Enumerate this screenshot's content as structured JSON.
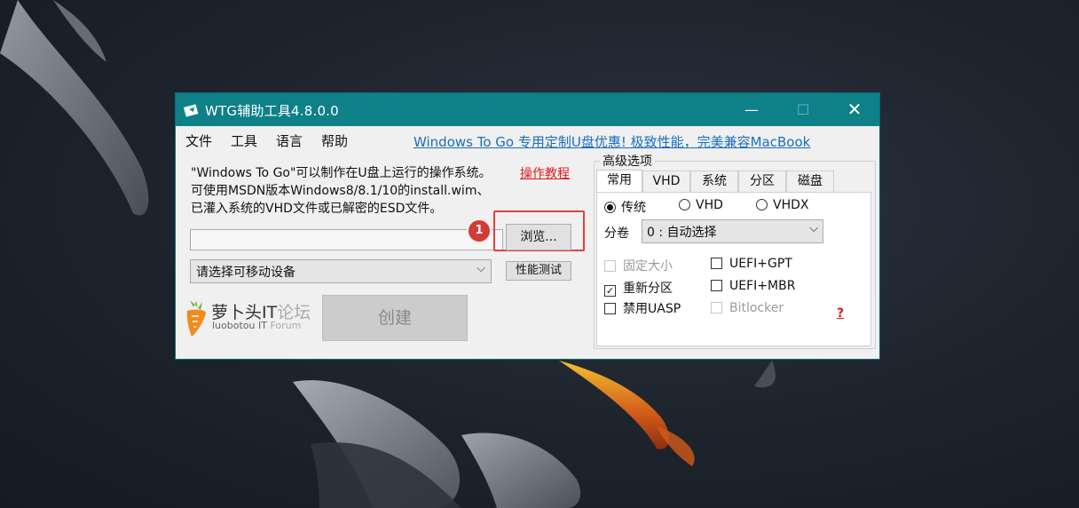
{
  "window": {
    "title": "WTG辅助工具4.8.0.0",
    "minimize_glyph": "—",
    "maximize_glyph": "☐",
    "close_glyph": "✕"
  },
  "menu": {
    "items": [
      "文件",
      "工具",
      "语言",
      "帮助"
    ],
    "promo_link": "Windows To Go 专用定制U盘优惠! 极致性能，完美兼容MacBook"
  },
  "description": {
    "lines": [
      "\"Windows To Go\"可以制作在U盘上运行的操作系统。",
      "可使用MSDN版本Windows8/8.1/10的install.wim、",
      "已灌入系统的VHD文件或已解密的ESD文件。"
    ],
    "tutorial_link": "操作教程"
  },
  "image_path": {
    "value": ""
  },
  "browse_button": "浏览...",
  "step_badge": "1",
  "device_select": {
    "value": "请选择可移动设备",
    "chevron": "⌵"
  },
  "perf_button": "性能测试",
  "logo": {
    "name_main": "萝卜头IT",
    "name_forum": "论坛",
    "sub_main": "luobotou IT",
    "sub_forum": "Forum"
  },
  "create_button": "创建",
  "advanced": {
    "title": "高级选项",
    "tabs": [
      "常用",
      "VHD",
      "系统",
      "分区",
      "磁盘"
    ],
    "active_tab": "常用",
    "mode_radios": [
      {
        "label": "传统",
        "checked": true
      },
      {
        "label": "VHD",
        "checked": false
      },
      {
        "label": "VHDX",
        "checked": false
      }
    ],
    "partition": {
      "label": "分卷",
      "value": "0 : 自动选择",
      "chevron": "⌵"
    },
    "checkboxes": [
      {
        "label": "固定大小",
        "checked": false,
        "enabled": false
      },
      {
        "label": "UEFI+GPT",
        "checked": false,
        "enabled": true
      },
      {
        "label": "重新分区",
        "checked": true,
        "enabled": true
      },
      {
        "label": "UEFI+MBR",
        "checked": false,
        "enabled": true
      },
      {
        "label": "禁用UASP",
        "checked": false,
        "enabled": true
      },
      {
        "label": "Bitlocker",
        "checked": false,
        "enabled": false
      }
    ],
    "help_link": "?"
  },
  "colors": {
    "titlebar": "#0e8088",
    "link_blue": "#1a6fbf",
    "link_red": "#e21a1a",
    "highlight": "#e04040",
    "logo_orange": "#f28a1c"
  }
}
